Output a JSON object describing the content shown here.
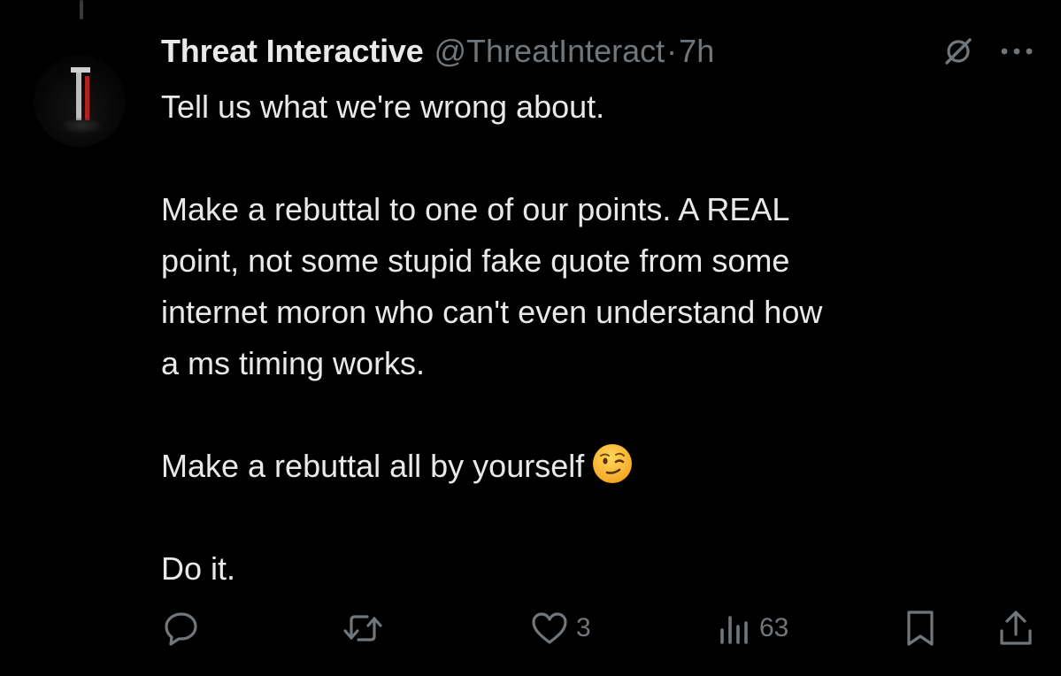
{
  "tweet": {
    "display_name": "Threat Interactive",
    "handle": "@ThreatInteract",
    "separator": "·",
    "time": "7h",
    "lines": [
      "Tell us what we're wrong about.",
      "",
      "Make a rebuttal to one of our points. A REAL",
      "point, not some stupid fake quote from some",
      "internet moron who can't even understand how",
      "a ms timing works.",
      "",
      "Make a rebuttal all by yourself",
      "",
      "Do it."
    ],
    "emoji": "winking-face"
  },
  "actions": {
    "likes": "3",
    "views": "63"
  },
  "colors": {
    "background": "#000000",
    "text": "#e7e9ea",
    "secondary": "#71767b",
    "avatar_accent": "#b32020"
  },
  "icons": [
    "grok-icon",
    "more-icon",
    "reply-icon",
    "retweet-icon",
    "like-icon",
    "views-icon",
    "bookmark-icon",
    "share-icon"
  ]
}
